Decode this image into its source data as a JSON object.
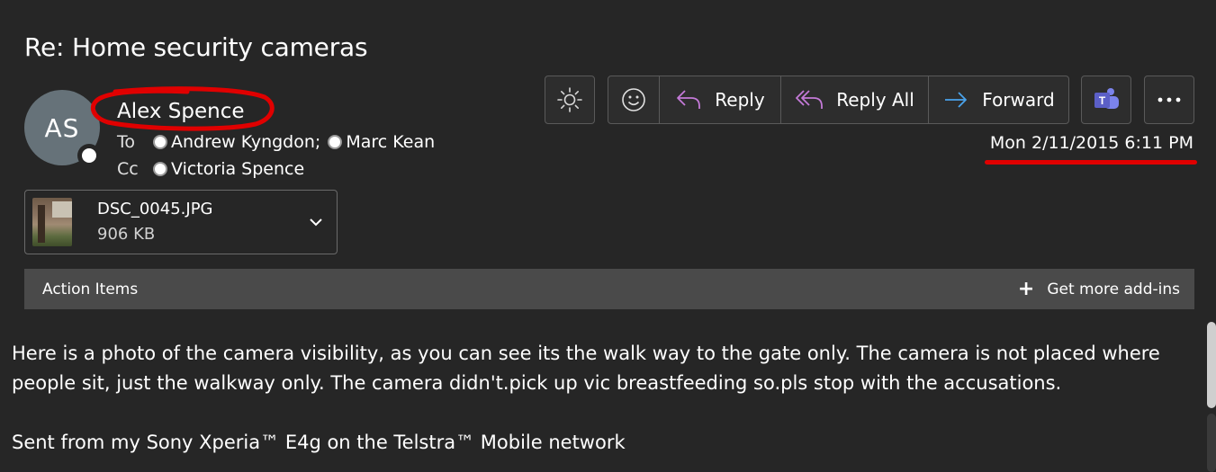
{
  "message": {
    "subject": "Re: Home security cameras",
    "sender": {
      "initials": "AS",
      "name": "Alex Spence"
    },
    "to_label": "To",
    "to": [
      "Andrew Kyngdon;",
      "Marc Kean"
    ],
    "cc_label": "Cc",
    "cc": [
      "Victoria Spence"
    ],
    "date": "Mon 2/11/2015 6:11 PM",
    "attachment": {
      "name": "DSC_0045.JPG",
      "size": "906 KB"
    },
    "body": [
      "Here is a photo of the camera visibility, as you can see its the walk way to the gate only. The camera is not placed where people sit, just the walkway only. The camera didn't.pick up vic breastfeeding so.pls stop with the accusations.",
      "",
      "Sent from my Sony Xperia™ E4g on the Telstra™ Mobile network"
    ]
  },
  "toolbar": {
    "theme_icon": "sun-icon",
    "emoji_icon": "smiley-icon",
    "reply_label": "Reply",
    "reply_all_label": "Reply All",
    "forward_label": "Forward",
    "teams_icon": "teams-icon",
    "more_icon": "more-icon"
  },
  "action_bar": {
    "label": "Action Items",
    "addins_label": "Get more add-ins"
  },
  "colors": {
    "background": "#262626",
    "avatar": "#667279",
    "annotation_red": "#e00000",
    "reply_icon": "#c47ad8",
    "forward_icon": "#4aa3ec",
    "teams": "#5b5fc7"
  }
}
